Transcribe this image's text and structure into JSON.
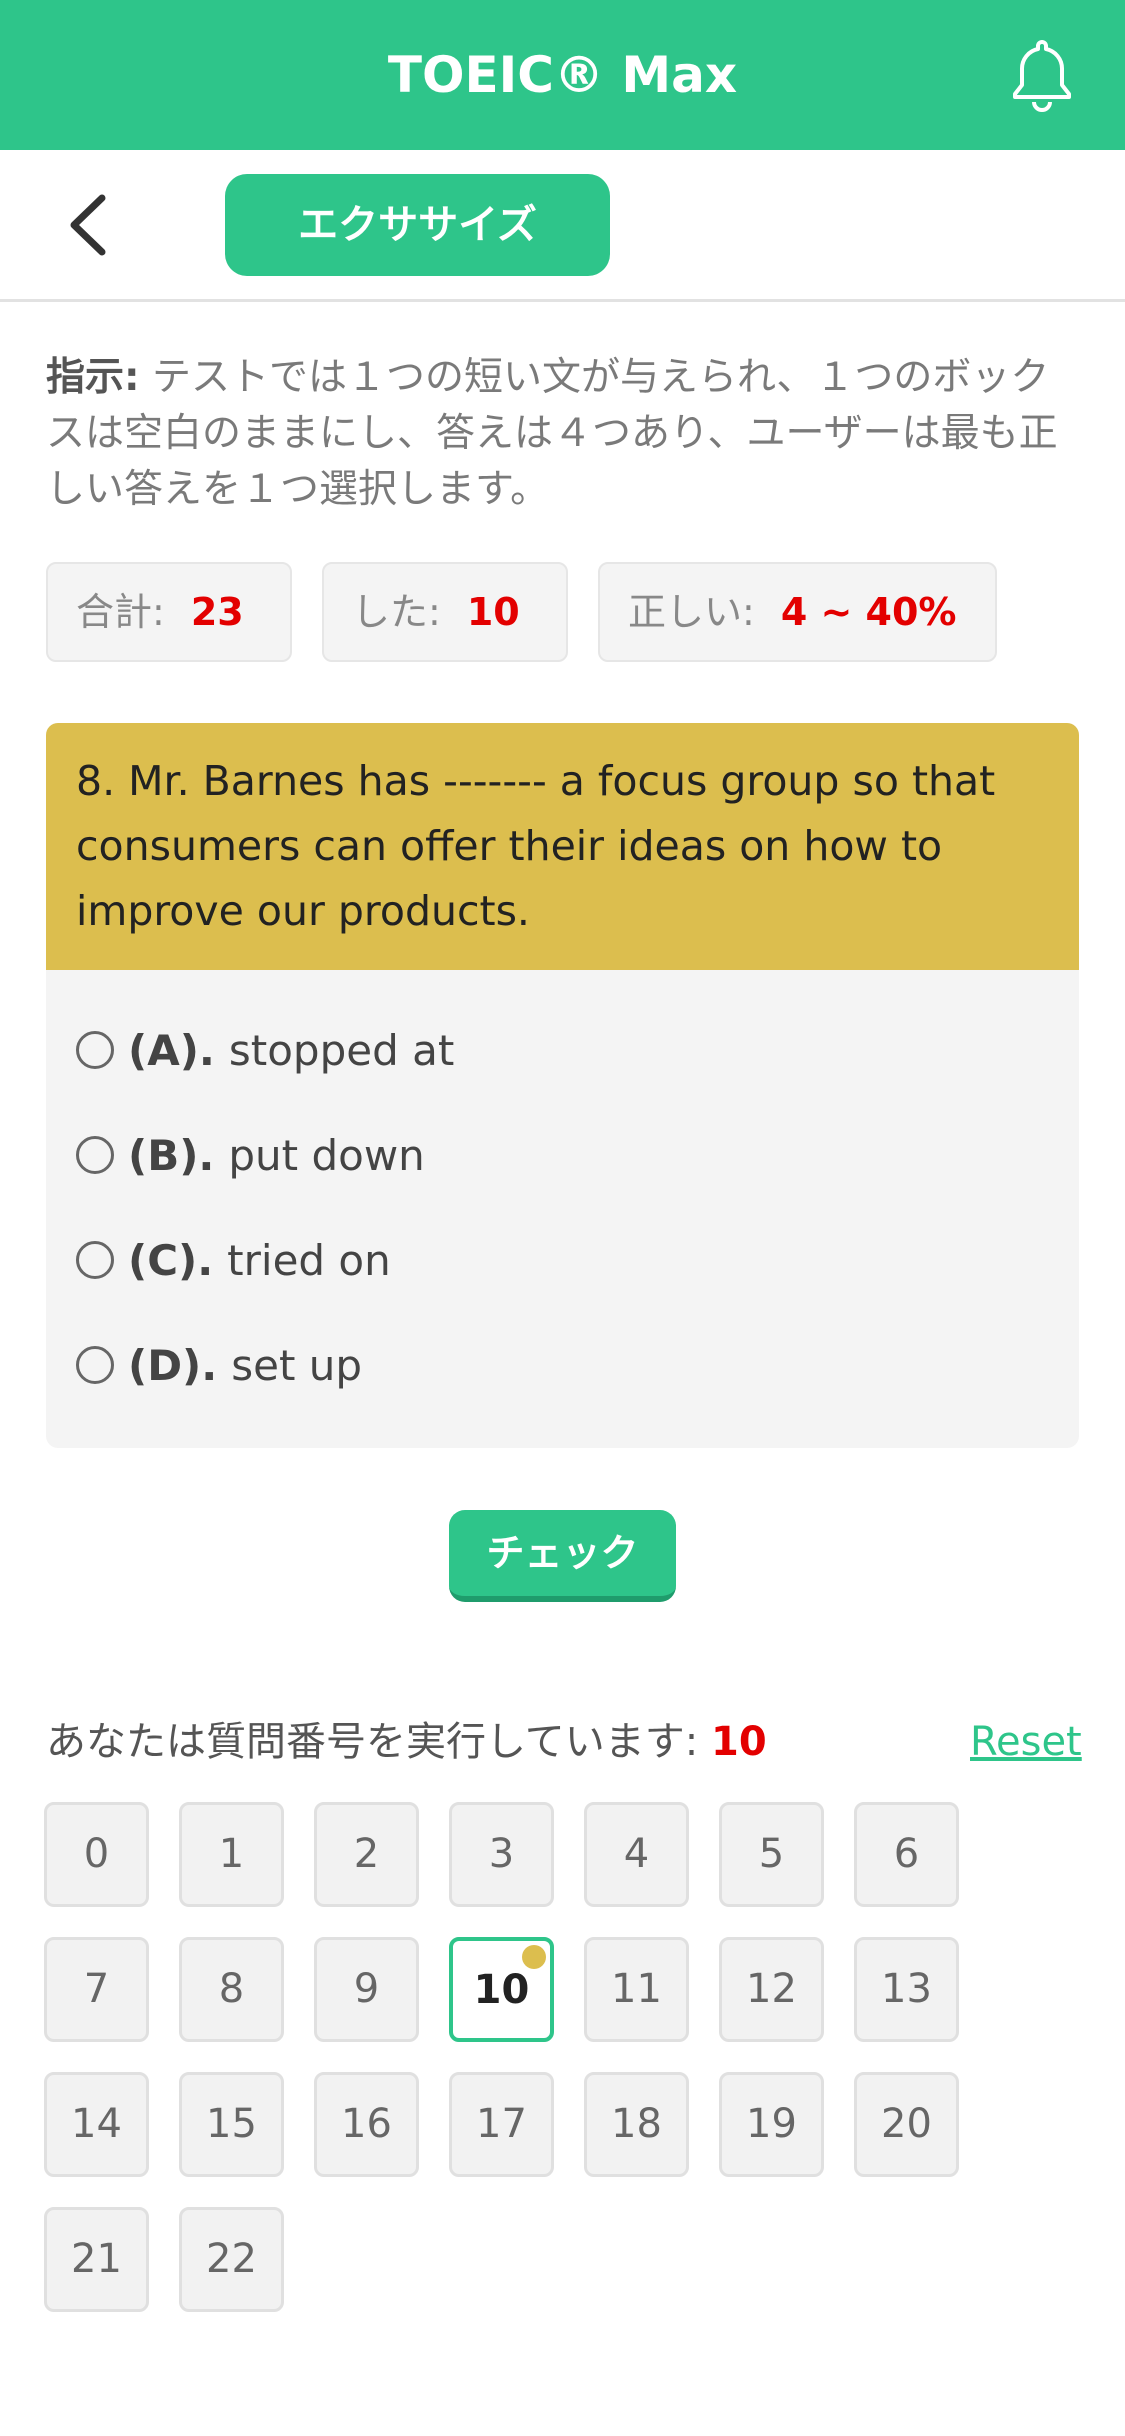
{
  "header": {
    "title": "TOEIC® Max"
  },
  "subheader": {
    "tab_label": "エクササイズ"
  },
  "instruction": {
    "label": "指示:",
    "text": " テストでは１つの短い文が与えられ、１つのボックスは空白のままにし、答えは４つあり、ユーザーは最も正しい答えを１つ選択します。"
  },
  "stats": {
    "total_label": "合計:",
    "total_value": "23",
    "done_label": "した:",
    "done_value": "10",
    "correct_label": "正しい:",
    "correct_value": "4 ~ 40%"
  },
  "question": {
    "text": "8. Mr. Barnes has ------- a focus group so that consumers can offer their ideas on how to improve our products.",
    "options": [
      {
        "key": "(A).",
        "text": "stopped at"
      },
      {
        "key": "(B).",
        "text": "put down"
      },
      {
        "key": "(C).",
        "text": "tried on"
      },
      {
        "key": "(D).",
        "text": "set up"
      }
    ]
  },
  "check_label": "チェック",
  "progress": {
    "label": "あなたは質問番号を実行しています:",
    "current": "10",
    "reset_label": "Reset"
  },
  "question_numbers": [
    "0",
    "1",
    "2",
    "3",
    "4",
    "5",
    "6",
    "7",
    "8",
    "9",
    "10",
    "11",
    "12",
    "13",
    "14",
    "15",
    "16",
    "17",
    "18",
    "19",
    "20",
    "21",
    "22"
  ],
  "active_question": "10",
  "colors": {
    "brand": "#2ec58a",
    "question_bg": "#dcbe4e",
    "accent_red": "#e30000"
  },
  "icons": {
    "notifications": "bell-icon",
    "back": "chevron-left-icon"
  }
}
